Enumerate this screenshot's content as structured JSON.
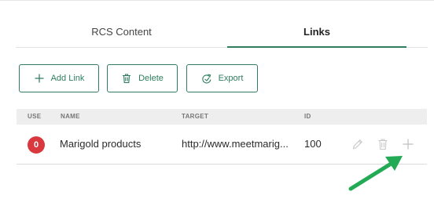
{
  "tabs": [
    {
      "label": "RCS Content",
      "active": false
    },
    {
      "label": "Links",
      "active": true
    }
  ],
  "toolbar": {
    "add_label": "Add Link",
    "delete_label": "Delete",
    "export_label": "Export"
  },
  "table": {
    "columns": [
      "USE",
      "NAME",
      "TARGET",
      "ID"
    ],
    "rows": [
      {
        "use": "0",
        "name": "Marigold products",
        "target": "http://www.meetmarig...",
        "id": "100"
      }
    ]
  },
  "icons": {
    "add": "plus-icon",
    "delete": "trash-icon",
    "export": "export-icon",
    "row_edit": "pencil-icon",
    "row_delete": "trash-icon",
    "row_add": "plus-icon",
    "annotation": "green-arrow"
  },
  "colors": {
    "accent": "#2e7d5f",
    "use_badge": "#d9393e",
    "header_bg": "#eeeeee",
    "annotation_arrow": "#22aa55",
    "disabled_icon": "#c8c8c8"
  }
}
